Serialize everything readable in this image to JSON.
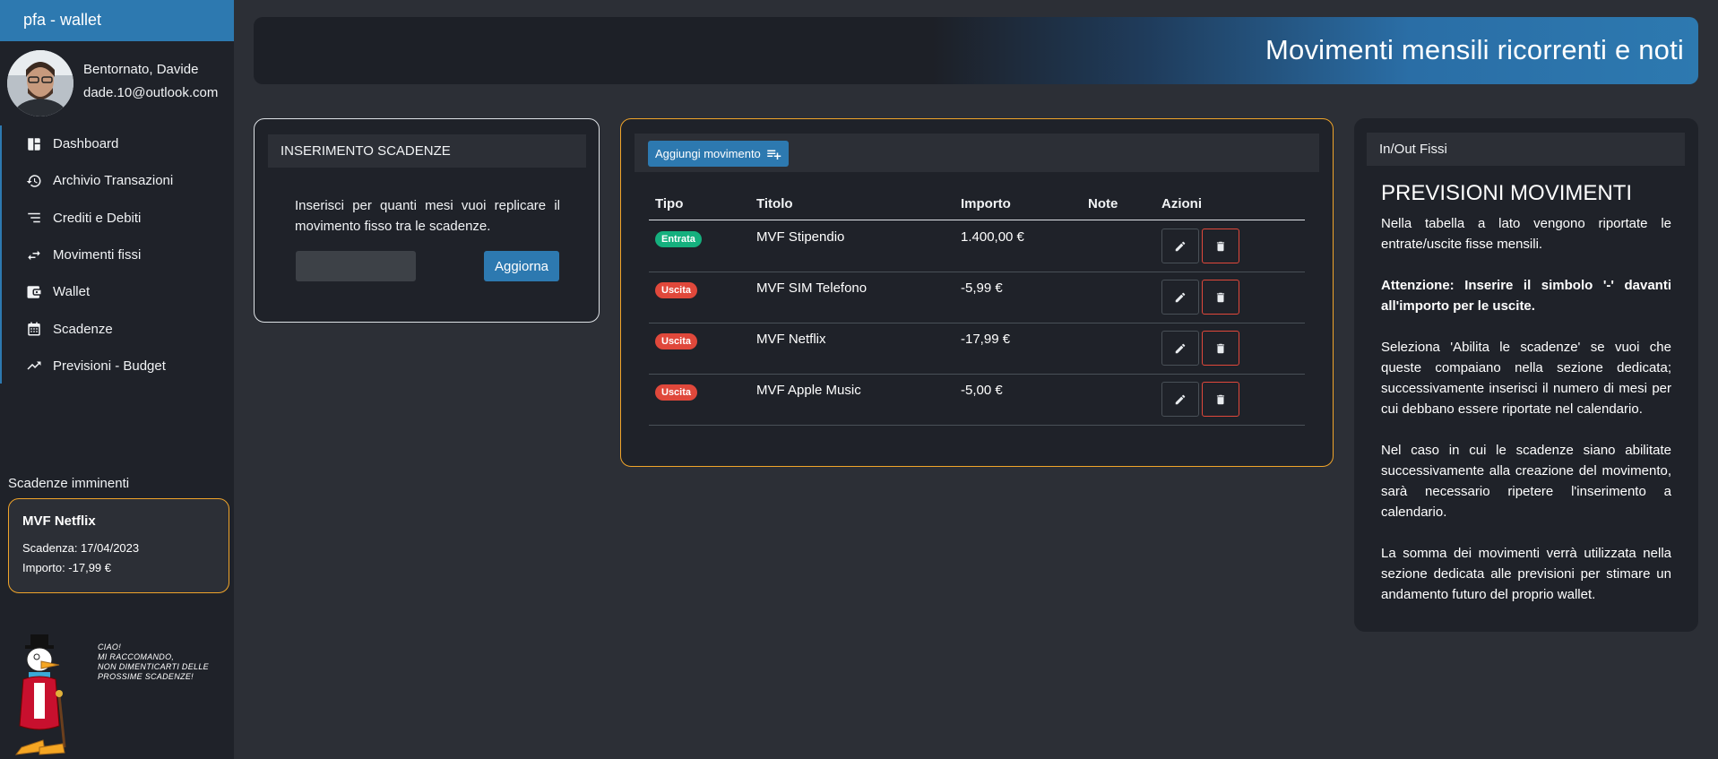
{
  "app": {
    "brand": "pfa - wallet"
  },
  "user": {
    "greeting": "Bentornato, Davide",
    "email": "dade.10@outlook.com"
  },
  "sidebar": {
    "items": [
      {
        "label": "Dashboard",
        "icon": "dashboard-icon"
      },
      {
        "label": "Archivio Transazioni",
        "icon": "history-icon"
      },
      {
        "label": "Crediti e Debiti",
        "icon": "sort-lines-icon"
      },
      {
        "label": "Movimenti fissi",
        "icon": "swap-arrows-icon"
      },
      {
        "label": "Wallet",
        "icon": "wallet-icon"
      },
      {
        "label": "Scadenze",
        "icon": "calendar-icon"
      },
      {
        "label": "Previsioni - Budget",
        "icon": "trending-up-icon"
      }
    ],
    "deadlines_title": "Scadenze imminenti",
    "deadline_card": {
      "title": "MVF Netflix",
      "date_line": "Scadenza: 17/04/2023",
      "amount_line": "Importo: -17,99 €"
    },
    "mascot_speech": [
      "CIAO!",
      "MI RACCOMANDO,",
      "NON DIMENTICARTI DELLE",
      "PROSSIME SCADENZE!"
    ]
  },
  "header": {
    "title": "Movimenti mensili ricorrenti e noti"
  },
  "insert_card": {
    "title": "INSERIMENTO SCADENZE",
    "text": "Inserisci per quanti mesi vuoi replicare il movimento fisso tra le scadenze.",
    "input_value": "",
    "button_label": "Aggiorna"
  },
  "table_card": {
    "add_button": "Aggiungi movimento",
    "columns": [
      "Tipo",
      "Titolo",
      "Importo",
      "Note",
      "Azioni"
    ],
    "rows": [
      {
        "type": "Entrata",
        "title": "MVF Stipendio",
        "amount": "1.400,00 €",
        "note": ""
      },
      {
        "type": "Uscita",
        "title": "MVF SIM Telefono",
        "amount": "-5,99 €",
        "note": ""
      },
      {
        "type": "Uscita",
        "title": "MVF Netflix",
        "amount": "-17,99 €",
        "note": ""
      },
      {
        "type": "Uscita",
        "title": "MVF Apple Music",
        "amount": "-5,00 €",
        "note": ""
      }
    ]
  },
  "info_card": {
    "header": "In/Out Fissi",
    "title": "PREVISIONI MOVIMENTI",
    "paragraphs": [
      "Nella tabella a lato vengono riportate le entrate/uscite fisse mensili.",
      "Attenzione: Inserire il simbolo '-' davanti all'importo per le uscite.",
      "Seleziona 'Abilita le scadenze' se vuoi che queste compaiano nella sezione dedicata; successivamente inserisci il numero di mesi per cui debbano essere riportate nel calendario.",
      "Nel caso in cui le scadenze siano abilitate successivamente alla creazione del movimento, sarà necessario ripetere l'inserimento a calendario.",
      "La somma dei movimenti verrà utilizzata nella sezione dedicata alle previsioni per stimare un andamento futuro del proprio wallet."
    ]
  },
  "colors": {
    "accent": "#2d79b0",
    "highlight_border": "#f0a42a",
    "income_badge": "#15b07e",
    "expense_badge": "#e0483b"
  }
}
